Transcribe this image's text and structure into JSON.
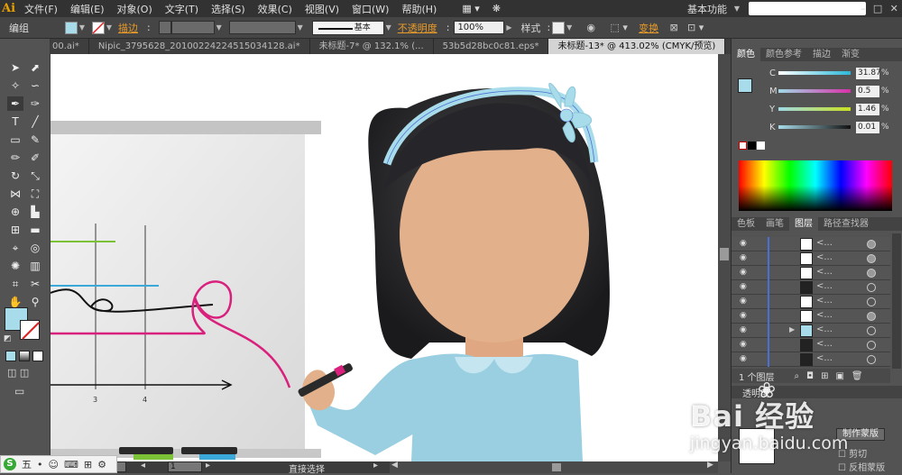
{
  "app": {
    "logo": "Ai"
  },
  "menubar": {
    "items": [
      "文件(F)",
      "编辑(E)",
      "对象(O)",
      "文字(T)",
      "选择(S)",
      "效果(C)",
      "视图(V)",
      "窗口(W)",
      "帮助(H)"
    ],
    "workspace": "基本功能",
    "window_controls": [
      "–",
      "□",
      "✕"
    ]
  },
  "controlbar": {
    "mode_label": "编组",
    "stroke_link": "描边",
    "stroke_style_label": "基本",
    "opacity_link": "不透明度",
    "opacity_value": "100%",
    "style_label": "样式",
    "transform_link": "变换",
    "fill_color": "#a8dcea",
    "stroke_color": "#ffffff"
  },
  "tabs": [
    {
      "label": "00.ai*",
      "active": false
    },
    {
      "label": "Nipic_3795628_20100224224515034128.ai*",
      "active": false
    },
    {
      "label": "未标题-7* @ 132.1% (...",
      "active": false
    },
    {
      "label": "53b5d28bc0c81.eps*",
      "active": false
    },
    {
      "label": "未标题-13* @ 413.02% (CMYK/预览)",
      "active": true
    }
  ],
  "toolbar": {
    "tools": [
      "selection-tool",
      "direct-selection-tool",
      "magic-wand-tool",
      "lasso-tool",
      "pen-tool",
      "curvature-tool",
      "type-tool",
      "line-tool",
      "rectangle-tool",
      "paintbrush-tool",
      "pencil-tool",
      "blob-brush-tool",
      "rotate-tool",
      "scale-tool",
      "width-tool",
      "free-transform-tool",
      "shape-builder-tool",
      "perspective-grid-tool",
      "mesh-tool",
      "gradient-tool",
      "eyedropper-tool",
      "blend-tool",
      "symbol-sprayer-tool",
      "column-graph-tool",
      "artboard-tool",
      "slice-tool",
      "hand-tool",
      "zoom-tool"
    ],
    "fill_color": "#a8dcea"
  },
  "canvas": {
    "ruler_labels": [
      "3",
      "4"
    ]
  },
  "statusbar": {
    "zoom": "",
    "page": "1",
    "tool_label": "直接选择"
  },
  "color_panel": {
    "tabs": [
      "颜色",
      "颜色参考",
      "描边",
      "渐变"
    ],
    "channels": [
      {
        "name": "C",
        "value": "31.87",
        "color": "#2ab8d8"
      },
      {
        "name": "M",
        "value": "0.5",
        "color": "#d830a8"
      },
      {
        "name": "Y",
        "value": "1.46",
        "color": "#d8d820"
      },
      {
        "name": "K",
        "value": "0.01",
        "color": "#333333"
      }
    ],
    "unit": "%"
  },
  "layers_panel": {
    "tabs": [
      "色板",
      "画笔",
      "图层",
      "路径查找器"
    ],
    "rows": [
      "<...",
      "<...",
      "<...",
      "<...",
      "<...",
      "<...",
      "<...",
      "<...",
      "<..."
    ],
    "footer_label": "1 个图层"
  },
  "transparency_panel": {
    "title": "透明度",
    "make_mask_button": "制作蒙版",
    "clip_label": "剪切",
    "invert_label": "反相蒙版"
  },
  "watermark": {
    "brand": "Bai 经验",
    "url": "jingyan.baidu.com"
  },
  "taskbar": {
    "items": [
      "S",
      "五",
      "•",
      "☺",
      "⌨",
      "⊞",
      "⚙"
    ]
  }
}
